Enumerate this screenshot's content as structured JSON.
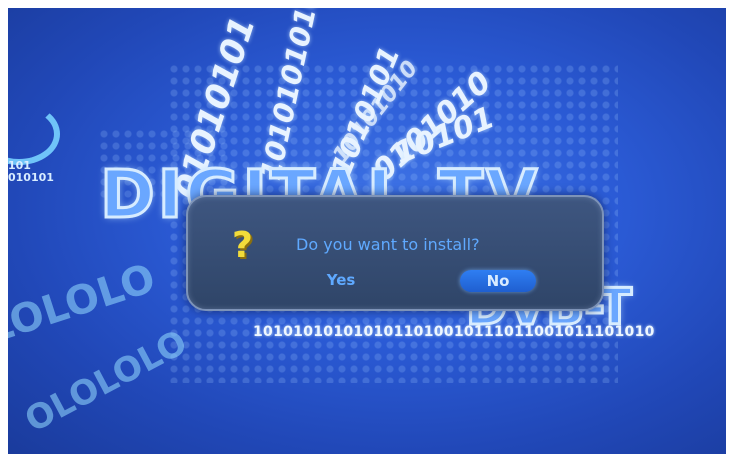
{
  "background": {
    "headline": "DIGITAL TV",
    "subtag": "DVB-T",
    "binary_line": "1010101010101011010010111011001011101010",
    "binary_small": "101\n010101",
    "streams": [
      "01010101",
      "1010101010",
      "10101010",
      "1010101",
      "0101010",
      "10101"
    ],
    "swirl_texts": [
      "LOLOLO",
      "OLOLOLO"
    ],
    "colors": {
      "screen": "#2b5bd6",
      "text_glow": "#d7ecff",
      "dialog_bg": "#334a70",
      "question_mark": "#f2dc3a",
      "selected_button": "#2f7ef2"
    }
  },
  "dialog": {
    "icon": "question-mark-icon",
    "icon_glyph": "?",
    "message": "Do you want to install?",
    "buttons": {
      "yes": "Yes",
      "no": "No",
      "selected": "No"
    }
  }
}
